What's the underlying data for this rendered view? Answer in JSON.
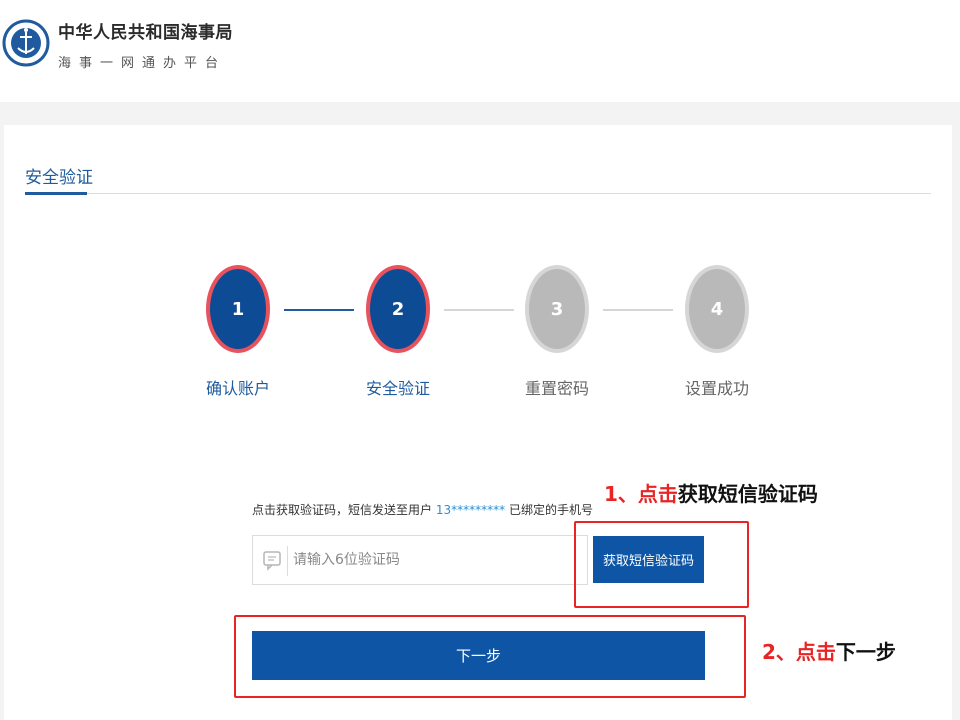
{
  "header": {
    "org_name": "中华人民共和国海事局",
    "platform_name": "海事一网通办平台",
    "logo_icon": "china-msa-anchor-emblem"
  },
  "tabs": {
    "security": "安全验证"
  },
  "steps": [
    {
      "number": "1",
      "label": "确认账户",
      "state": "done"
    },
    {
      "number": "2",
      "label": "安全验证",
      "state": "current"
    },
    {
      "number": "3",
      "label": "重置密码",
      "state": "pending"
    },
    {
      "number": "4",
      "label": "设置成功",
      "state": "pending"
    }
  ],
  "verify": {
    "hint_prefix": "点击获取验证码，短信发送至用户",
    "masked_phone": "13*********",
    "hint_suffix": "已绑定的手机号",
    "input_placeholder": "请输入6位验证码",
    "input_icon": "message-icon",
    "sms_button": "获取短信验证码",
    "next_button": "下一步"
  },
  "annotations": {
    "step1": {
      "index": "1、",
      "action": "点击",
      "target": "获取短信验证码"
    },
    "step2": {
      "index": "2、",
      "action": "点击",
      "target": "下一步"
    }
  },
  "colors": {
    "primary": "#0e56a5",
    "accent_red": "#e82424",
    "step_active_ring": "#e8525d",
    "step_inactive": "#b9b9b9"
  }
}
